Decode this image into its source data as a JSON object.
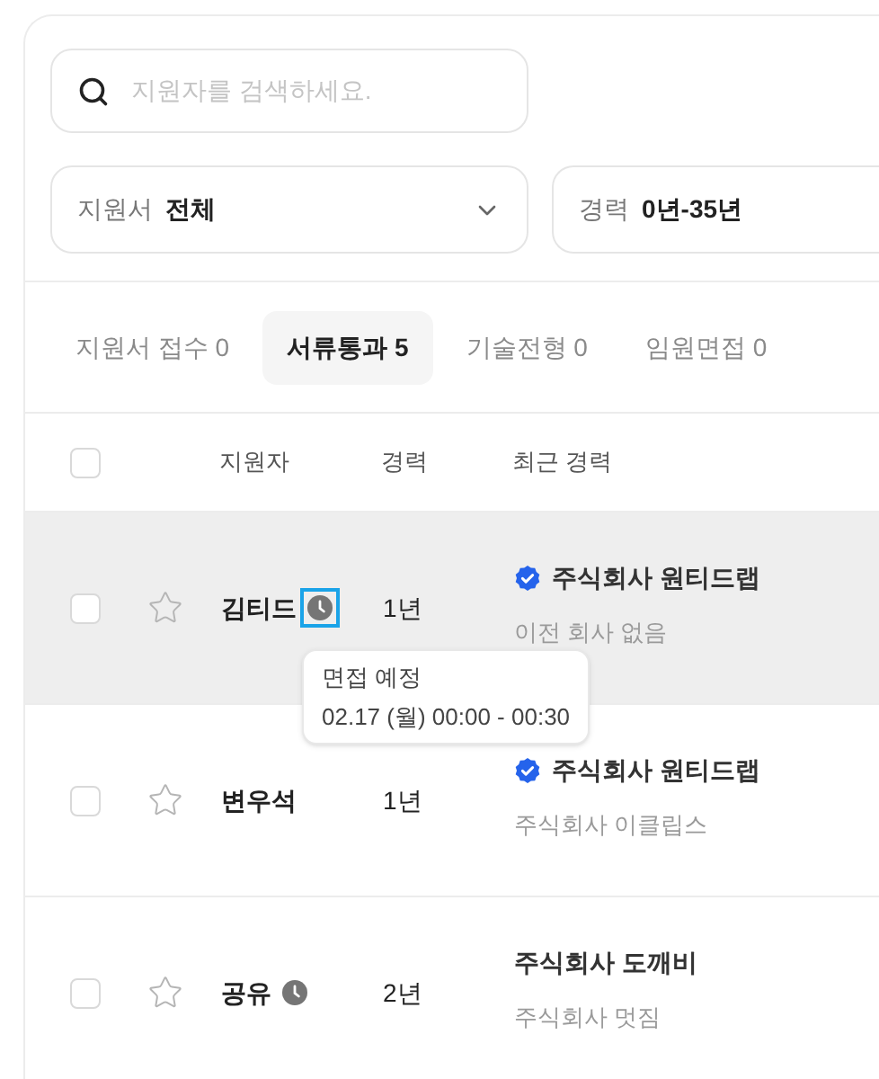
{
  "search": {
    "placeholder": "지원자를 검색하세요."
  },
  "filters": [
    {
      "kind": "select",
      "label": "지원서",
      "value": "전체"
    },
    {
      "kind": "range",
      "label": "경력",
      "value": "0년-35년"
    }
  ],
  "tabs": [
    {
      "label": "지원서 접수 0",
      "selected": false
    },
    {
      "label": "서류통과 5",
      "selected": true
    },
    {
      "label": "기술전형 0",
      "selected": false
    },
    {
      "label": "임원면접 0",
      "selected": false
    }
  ],
  "table": {
    "select_all_checked": false,
    "columns": [
      "지원자",
      "경력",
      "최근 경력"
    ],
    "rows": [
      {
        "checked": false,
        "starred": false,
        "hovered": true,
        "name": "김티드",
        "scheduled": true,
        "focused": true,
        "career": "1년",
        "current_company": "주식회사 원티드랩",
        "verified": true,
        "previous_company": "이전 회사 없음",
        "tooltip": {
          "title": "면접 예정",
          "time": "02.17 (월) 00:00 - 00:30"
        }
      },
      {
        "checked": false,
        "starred": false,
        "hovered": false,
        "name": "변우석",
        "scheduled": false,
        "focused": false,
        "career": "1년",
        "current_company": "주식회사 원티드랩",
        "verified": true,
        "previous_company": "주식회사 이클립스"
      },
      {
        "checked": false,
        "starred": false,
        "hovered": false,
        "name": "공유",
        "scheduled": true,
        "focused": false,
        "career": "2년",
        "current_company": "주식회사 도깨비",
        "verified": false,
        "previous_company": "주식회사 멋짐"
      }
    ]
  }
}
